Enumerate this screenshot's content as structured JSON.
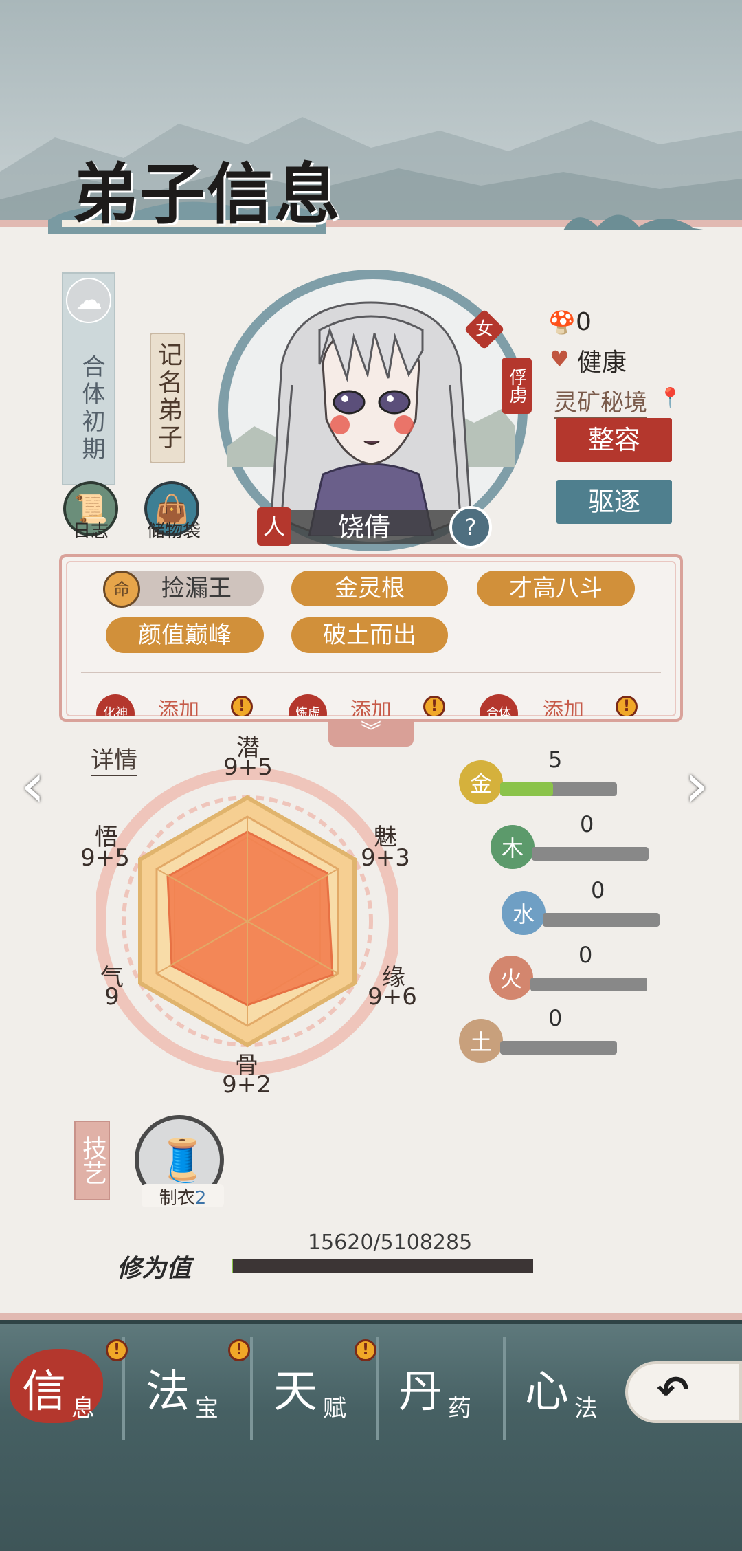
{
  "header": {
    "title": "弟子信息"
  },
  "rank": {
    "cultivation_stage": "合体初期",
    "role": "记名弟子"
  },
  "quick_buttons": {
    "log": "日志",
    "storage": "储物袋"
  },
  "character": {
    "name": "饶倩",
    "gender": "女",
    "status_tag": "俘虏",
    "left_badge": "人",
    "right_badge": "?"
  },
  "status": {
    "count": "0",
    "health": "健康",
    "location": "灵矿秘境"
  },
  "actions": {
    "makeover": "整容",
    "expel": "驱逐"
  },
  "traits": {
    "row1": [
      "捡漏王",
      "金灵根",
      "才高八斗"
    ],
    "row2": [
      "颜值巅峰",
      "破土而出"
    ],
    "first_icon": "命",
    "add_slots": [
      {
        "tag": "化神",
        "label": "添加"
      },
      {
        "tag": "炼虚",
        "label": "添加"
      },
      {
        "tag": "合体",
        "label": "添加"
      }
    ]
  },
  "details_link": "详情",
  "stats": {
    "top": {
      "name": "潜",
      "value": "9+5"
    },
    "upper_right": {
      "name": "魅",
      "value": "9+3"
    },
    "lower_right": {
      "name": "缘",
      "value": "9+6"
    },
    "bottom": {
      "name": "骨",
      "value": "9+2"
    },
    "lower_left": {
      "name": "气",
      "value": "9"
    },
    "upper_left": {
      "name": "悟",
      "value": "9+5"
    }
  },
  "elements": [
    {
      "name": "金",
      "value": "5",
      "fill": 0.45,
      "color": "#d5b13c"
    },
    {
      "name": "木",
      "value": "0",
      "fill": 0,
      "color": "#5c9a6b"
    },
    {
      "name": "水",
      "value": "0",
      "fill": 0,
      "color": "#6f9fc4"
    },
    {
      "name": "火",
      "value": "0",
      "fill": 0,
      "color": "#d3866e"
    },
    {
      "name": "土",
      "value": "0",
      "fill": 0,
      "color": "#c8a07c"
    }
  ],
  "skills": {
    "section": "技艺",
    "item": "制衣",
    "level": "2"
  },
  "cultivation": {
    "label": "修为值",
    "value": "15620/5108285",
    "progress": 0.003
  },
  "nav": [
    {
      "big": "信",
      "small": "息",
      "active": true,
      "badge": false
    },
    {
      "big": "法",
      "small": "宝",
      "active": false,
      "badge": true
    },
    {
      "big": "天",
      "small": "赋",
      "active": false,
      "badge": true
    },
    {
      "big": "丹",
      "small": "药",
      "active": false,
      "badge": true
    },
    {
      "big": "心",
      "small": "法",
      "active": false,
      "badge": false
    }
  ],
  "colors": {
    "accent_red": "#b4372d",
    "teal": "#4f7f8e",
    "gold": "#d1903a"
  }
}
